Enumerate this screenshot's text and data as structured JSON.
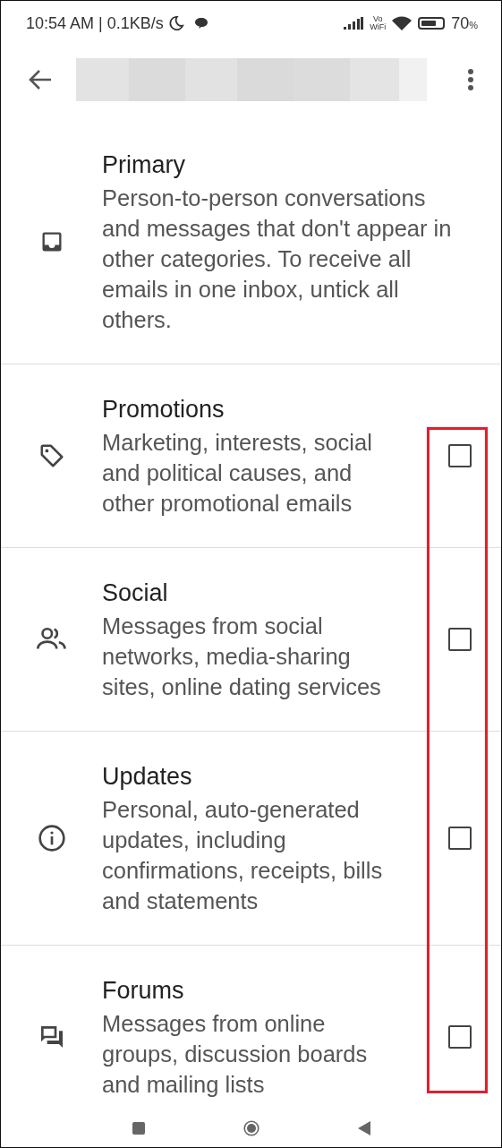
{
  "status_bar": {
    "time": "10:54 AM",
    "separator": "|",
    "speed": "0.1KB/s",
    "vo": "Vo",
    "wifi_label": "WiFi",
    "battery": "70",
    "percent": "%"
  },
  "toolbar": {
    "title": {
      "kind": "redacted"
    }
  },
  "categories": [
    {
      "kind": "inbox",
      "title": "Primary",
      "description": "Person-to-person conversations and messages that don't appear in other categories. To receive all emails in one inbox, untick all others."
    },
    {
      "kind": "tag",
      "title": "Promotions",
      "description": "Marketing, interests, social and political causes, and other promotional emails",
      "checked": false
    },
    {
      "kind": "people",
      "title": "Social",
      "description": "Messages from social networks, media-sharing sites, online dating services",
      "checked": false
    },
    {
      "kind": "info",
      "title": "Updates",
      "description": "Personal, auto-generated updates, including confirmations, receipts, bills and statements",
      "checked": false
    },
    {
      "kind": "forum",
      "title": "Forums",
      "description": "Messages from online groups, discussion boards and mailing lists",
      "checked": false
    }
  ],
  "annotation": {
    "kind": "highlight-box",
    "color": "#e0202a"
  }
}
